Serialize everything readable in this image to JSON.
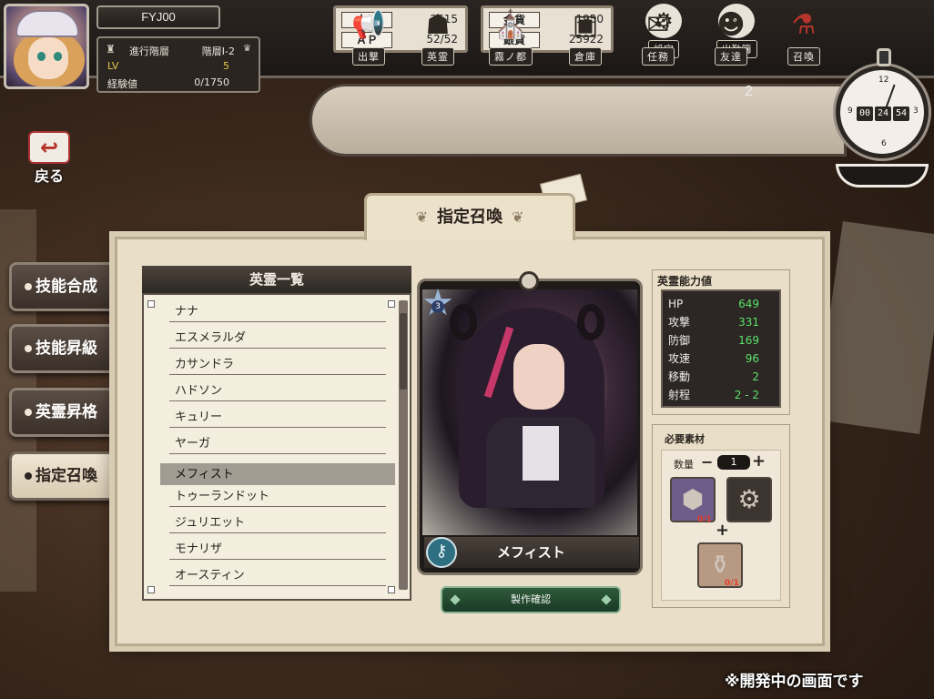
{
  "player": {
    "name": "FYJ00",
    "floor_label": "進行階層",
    "floor_value": "階層I-2",
    "lv_label": "LV",
    "lv_value": "5",
    "exp_label": "経験値",
    "exp_value": "0/1750"
  },
  "resources": {
    "crystal_label": "水晶",
    "crystal_value": "2615",
    "ap_label": "ＡＰ",
    "ap_value": "52/52",
    "gold_label": "金貨",
    "gold_value": "1950",
    "silver_label": "銀貨",
    "silver_value": "25922"
  },
  "top_buttons": {
    "settings": "設定",
    "attendance": "出勤簿"
  },
  "nav": {
    "items": [
      {
        "label": "出撃",
        "icon": "megaphone-icon"
      },
      {
        "label": "英霊",
        "icon": "bust-icon"
      },
      {
        "label": "霧ノ都",
        "icon": "castle-icon"
      },
      {
        "label": "倉庫",
        "icon": "suitcase-icon"
      },
      {
        "label": "任務",
        "icon": "scroll-icon"
      },
      {
        "label": "友達",
        "icon": "friends-icon"
      },
      {
        "label": "召喚",
        "icon": "flask-icon"
      }
    ],
    "friends_badge": "2"
  },
  "clock": {
    "hh": "00",
    "mm": "24",
    "ss": "54",
    "numbers": [
      "12",
      "3",
      "6",
      "9"
    ]
  },
  "back": {
    "label": "戻る"
  },
  "side_menu": [
    {
      "label": "技能合成",
      "active": false
    },
    {
      "label": "技能昇級",
      "active": false
    },
    {
      "label": "英霊昇格",
      "active": false
    },
    {
      "label": "指定召喚",
      "active": true
    }
  ],
  "panel": {
    "title": "指定召喚"
  },
  "hero_list": {
    "header": "英霊一覧",
    "items": [
      "ナナ",
      "エスメラルダ",
      "カサンドラ",
      "ハドソン",
      "キュリー",
      "ヤーガ",
      "メフィスト",
      "トゥーランドット",
      "ジュリエット",
      "モナリザ",
      "オースティン"
    ],
    "selected_index": 6
  },
  "hero_card": {
    "rarity": "3",
    "name": "メフィスト",
    "craft_button": "製作確認"
  },
  "stats": {
    "header": "英霊能力値",
    "rows": [
      {
        "label": "HP",
        "value": "649"
      },
      {
        "label": "攻撃",
        "value": "331"
      },
      {
        "label": "防御",
        "value": "169"
      },
      {
        "label": "攻速",
        "value": "96"
      },
      {
        "label": "移動",
        "value": "2"
      },
      {
        "label": "射程",
        "value": "2 - 2"
      }
    ]
  },
  "materials": {
    "header": "必要素材",
    "qty_label": "数量",
    "qty_value": "1",
    "slot1_count": "0/1",
    "slot3_count": "0/1"
  },
  "footer_note": "※開発中の画面です",
  "colors": {
    "stat_value": "#5ce26a",
    "material_missing": "#e43c28",
    "craft_button": "#2f5a3b"
  }
}
